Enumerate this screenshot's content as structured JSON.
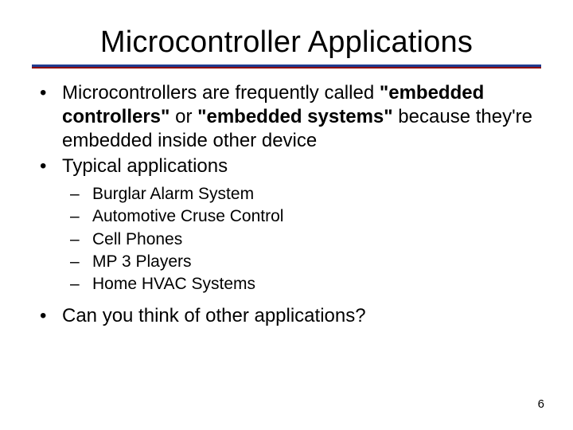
{
  "title": "Microcontroller Applications",
  "b1": {
    "pre": "Microcontrollers are frequently called ",
    "bold1": "\"embedded controllers\"",
    "mid": "  or ",
    "bold2": "\"embedded systems\"",
    "post": "  because they're embedded inside other device"
  },
  "b2": "Typical applications",
  "sub": [
    "Burglar Alarm System",
    "Automotive Cruse Control",
    "Cell Phones",
    "MP 3 Players",
    "Home HVAC Systems"
  ],
  "b3": "Can you think of other applications?",
  "page": "6",
  "glyph_bullet": "•",
  "glyph_dash": "–"
}
